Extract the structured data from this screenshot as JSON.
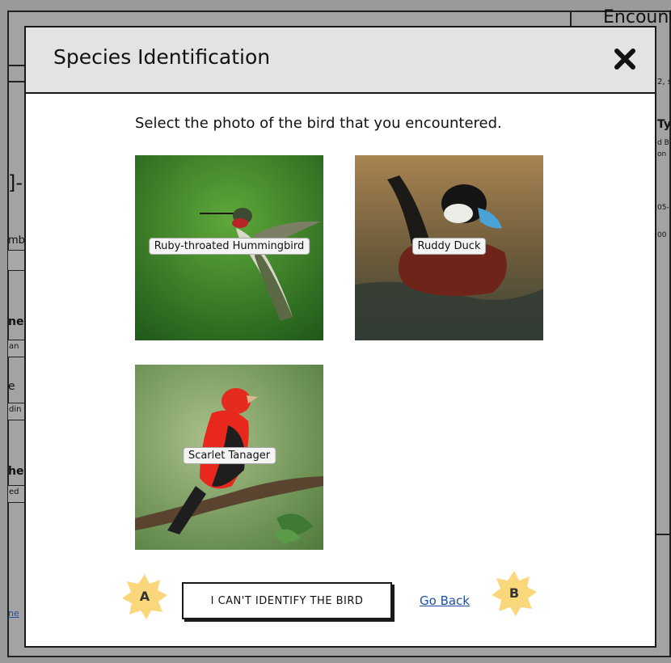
{
  "background_page": {
    "title_fragment": "Encounte",
    "fragments": [
      "]-",
      "mb",
      "ne",
      "an",
      "e",
      "din",
      "he",
      "ed",
      "ne"
    ],
    "right_fragments": [
      "2, s",
      "Ty",
      "d B",
      "on",
      "05-",
      "00"
    ]
  },
  "modal": {
    "title": "Species Identification",
    "instruction": "Select the photo of the bird that you encountered.",
    "birds": [
      {
        "label": "Ruby-throated Hummingbird"
      },
      {
        "label": "Ruddy Duck"
      },
      {
        "label": "Scarlet Tanager"
      }
    ],
    "cant_identify_label": "I CAN'T IDENTIFY THE BIRD",
    "go_back_label": "Go Back",
    "callouts": [
      "A",
      "B"
    ]
  },
  "colors": {
    "callout": "#fbd77c",
    "link": "#1f4fa3",
    "header_bg": "#e3e3e3"
  }
}
